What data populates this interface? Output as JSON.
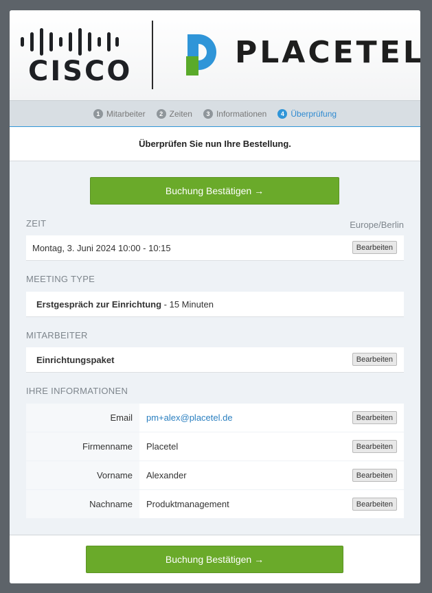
{
  "logos": {
    "cisco": "CISCO",
    "placetel": "PLACETEL"
  },
  "steps": [
    {
      "num": "1",
      "label": "Mitarbeiter"
    },
    {
      "num": "2",
      "label": "Zeiten"
    },
    {
      "num": "3",
      "label": "Informationen"
    },
    {
      "num": "4",
      "label": "Überprüfung"
    }
  ],
  "subtitle": "Überprüfen Sie nun Ihre Bestellung.",
  "confirm_label": "Buchung Bestätigen →",
  "edit_label": "Bearbeiten",
  "zeit": {
    "label": "ZEIT",
    "timezone": "Europe/Berlin",
    "value": "Montag, 3. Juni 2024 10:00 - 10:15"
  },
  "meeting_type": {
    "label": "MEETING TYPE",
    "name": "Erstgespräch zur Einrichtung",
    "duration": " - 15 Minuten"
  },
  "mitarbeiter": {
    "label": "MITARBEITER",
    "value": "Einrichtungspaket"
  },
  "info": {
    "label": "IHRE INFORMATIONEN",
    "rows": [
      {
        "key": "Email",
        "value": "pm+alex@placetel.de"
      },
      {
        "key": "Firmenname",
        "value": "Placetel"
      },
      {
        "key": "Vorname",
        "value": "Alexander"
      },
      {
        "key": "Nachname",
        "value": "Produktmanagement"
      }
    ]
  },
  "colors": {
    "accent_green": "#6aaa2a",
    "accent_blue": "#2f95d8",
    "placetel_green": "#5aaa2a"
  }
}
